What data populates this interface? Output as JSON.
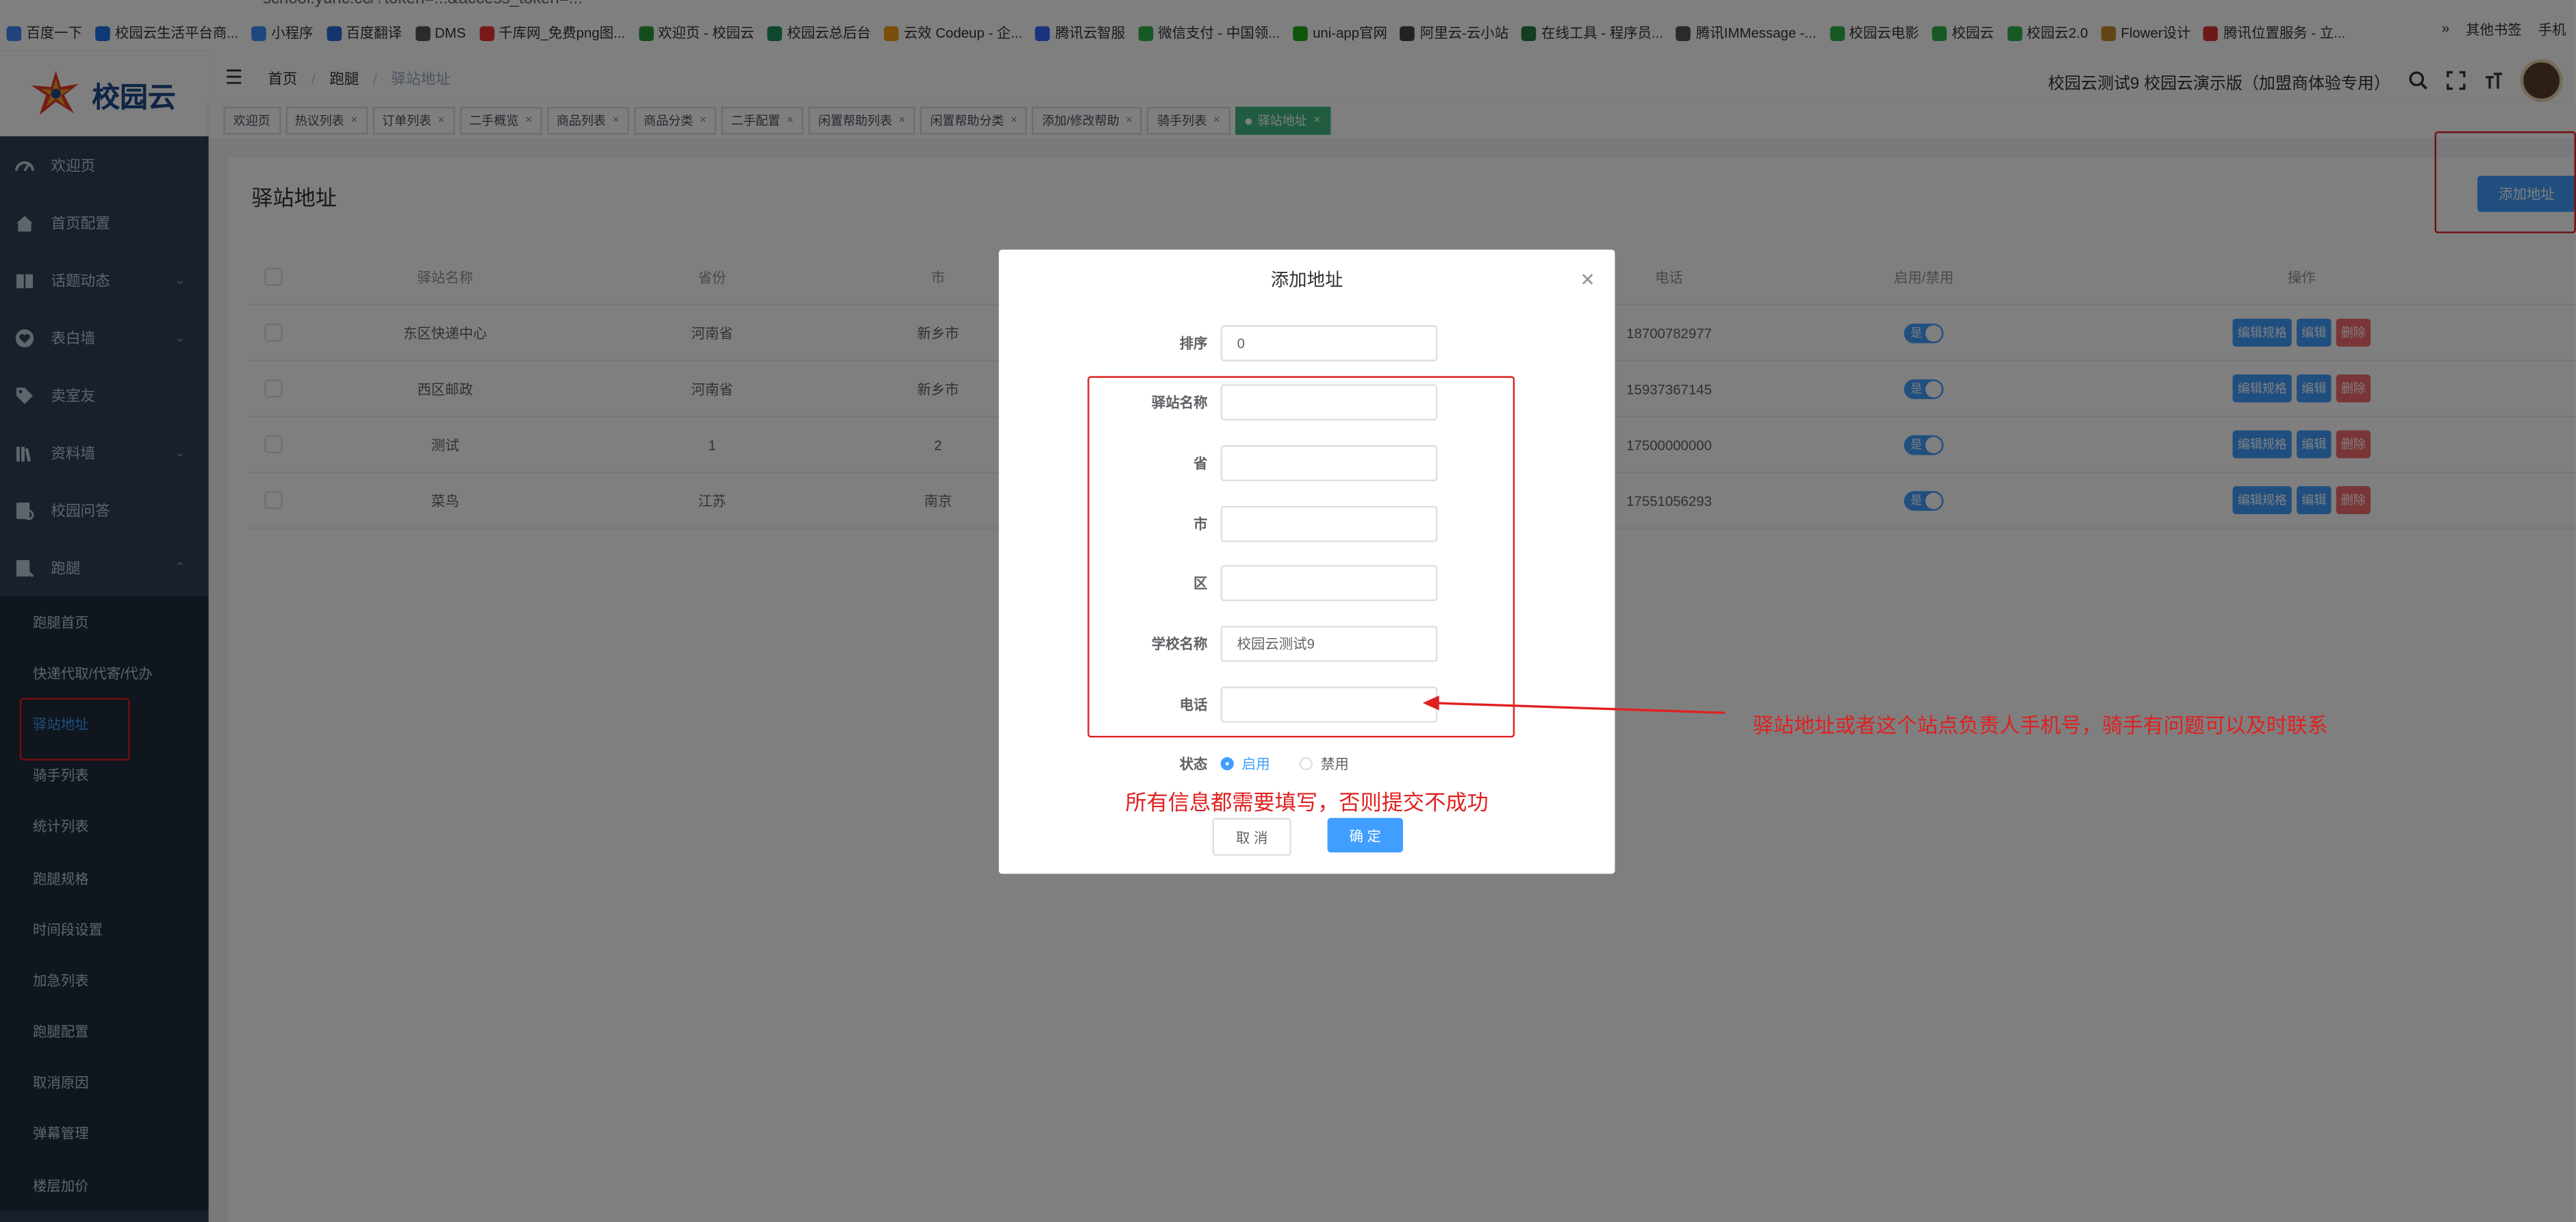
{
  "browser": {
    "address_fragment": "school.yunc.cc/?token=...&access_token=...",
    "bookmarks": [
      "百度一下",
      "校园云生活平台商...",
      "小程序",
      "百度翻译",
      "DMS",
      "千库网_免费png图...",
      "欢迎页 - 校园云",
      "校园云总后台",
      "云效 Codeup - 企...",
      "腾讯云智服",
      "微信支付 - 中国领...",
      "uni-app官网",
      "阿里云-云小站",
      "在线工具 - 程序员...",
      "腾讯IMMessage -...",
      "校园云电影",
      "校园云",
      "校园云2.0",
      "Flower设计",
      "腾讯位置服务 - 立..."
    ],
    "bookmarks_right": [
      "»",
      "其他书签",
      "手机"
    ]
  },
  "logo": {
    "text": "校园云"
  },
  "sidebar": {
    "items": [
      {
        "label": "欢迎页",
        "icon": "dashboard-icon",
        "chevron": false
      },
      {
        "label": "首页配置",
        "icon": "home-icon",
        "chevron": false
      },
      {
        "label": "话题动态",
        "icon": "book-icon",
        "chevron": true
      },
      {
        "label": "表白墙",
        "icon": "heart-icon",
        "chevron": true
      },
      {
        "label": "卖室友",
        "icon": "tag-icon",
        "chevron": false
      },
      {
        "label": "资料墙",
        "icon": "library-icon",
        "chevron": true
      },
      {
        "label": "校园问答",
        "icon": "qa-icon",
        "chevron": false
      },
      {
        "label": "跑腿",
        "icon": "errand-icon",
        "chevron": true
      }
    ],
    "subitems": [
      "跑腿首页",
      "快递代取/代寄/代办",
      "驿站地址",
      "骑手列表",
      "统计列表",
      "跑腿规格",
      "时间段设置",
      "加急列表",
      "跑腿配置",
      "取消原因",
      "弹幕管理",
      "楼层加价"
    ],
    "active_subitem": "驿站地址"
  },
  "navbar": {
    "breadcrumb": [
      "首页",
      "跑腿",
      "驿站地址"
    ],
    "school_title": "校园云测试9 校园云演示版（加盟商体验专用）"
  },
  "tags": [
    {
      "label": "欢迎页",
      "closable": false
    },
    {
      "label": "热议列表",
      "closable": true
    },
    {
      "label": "订单列表",
      "closable": true
    },
    {
      "label": "二手概览",
      "closable": true
    },
    {
      "label": "商品列表",
      "closable": true
    },
    {
      "label": "商品分类",
      "closable": true
    },
    {
      "label": "二手配置",
      "closable": true
    },
    {
      "label": "闲置帮助列表",
      "closable": true
    },
    {
      "label": "闲置帮助分类",
      "closable": true
    },
    {
      "label": "添加/修改帮助",
      "closable": true
    },
    {
      "label": "骑手列表",
      "closable": true
    },
    {
      "label": "驿站地址",
      "closable": true,
      "active": true
    }
  ],
  "page": {
    "title": "驿站地址",
    "add_button": "添加地址"
  },
  "table": {
    "headers": {
      "name": "驿站名称",
      "province": "省份",
      "city": "市",
      "phone": "电话",
      "status": "启用/禁用",
      "ops": "操作"
    },
    "rows": [
      {
        "name": "东区快递中心",
        "province": "河南省",
        "city": "新乡市",
        "phone": "18700782977",
        "status": "是"
      },
      {
        "name": "西区邮政",
        "province": "河南省",
        "city": "新乡市",
        "phone": "15937367145",
        "status": "是"
      },
      {
        "name": "测试",
        "province": "1",
        "city": "2",
        "phone": "17500000000",
        "status": "是"
      },
      {
        "name": "菜鸟",
        "province": "江苏",
        "city": "南京",
        "phone": "17551056293",
        "status": "是"
      }
    ],
    "op_labels": {
      "spec": "编辑规格",
      "edit": "编辑",
      "delete": "删除"
    }
  },
  "dialog": {
    "title": "添加地址",
    "fields": {
      "sort": {
        "label": "排序",
        "value": "0"
      },
      "station_name": {
        "label": "驿站名称",
        "value": ""
      },
      "province": {
        "label": "省",
        "value": ""
      },
      "city": {
        "label": "市",
        "value": ""
      },
      "district": {
        "label": "区",
        "value": ""
      },
      "school": {
        "label": "学校名称",
        "value": "校园云测试9"
      },
      "phone": {
        "label": "电话",
        "value": ""
      }
    },
    "status": {
      "label": "状态",
      "options": [
        "启用",
        "禁用"
      ],
      "selected": "启用"
    },
    "note": "所有信息都需要填写，否则提交不成功",
    "cancel": "取 消",
    "confirm": "确 定"
  },
  "annotation": {
    "text": "驿站地址或者这个站点负责人手机号，骑手有问题可以及时联系",
    "color": "#e02020"
  },
  "colors": {
    "primary": "#409eff",
    "sidebar": "#304156",
    "danger": "#f56c6c",
    "tag_active": "#42b983"
  }
}
